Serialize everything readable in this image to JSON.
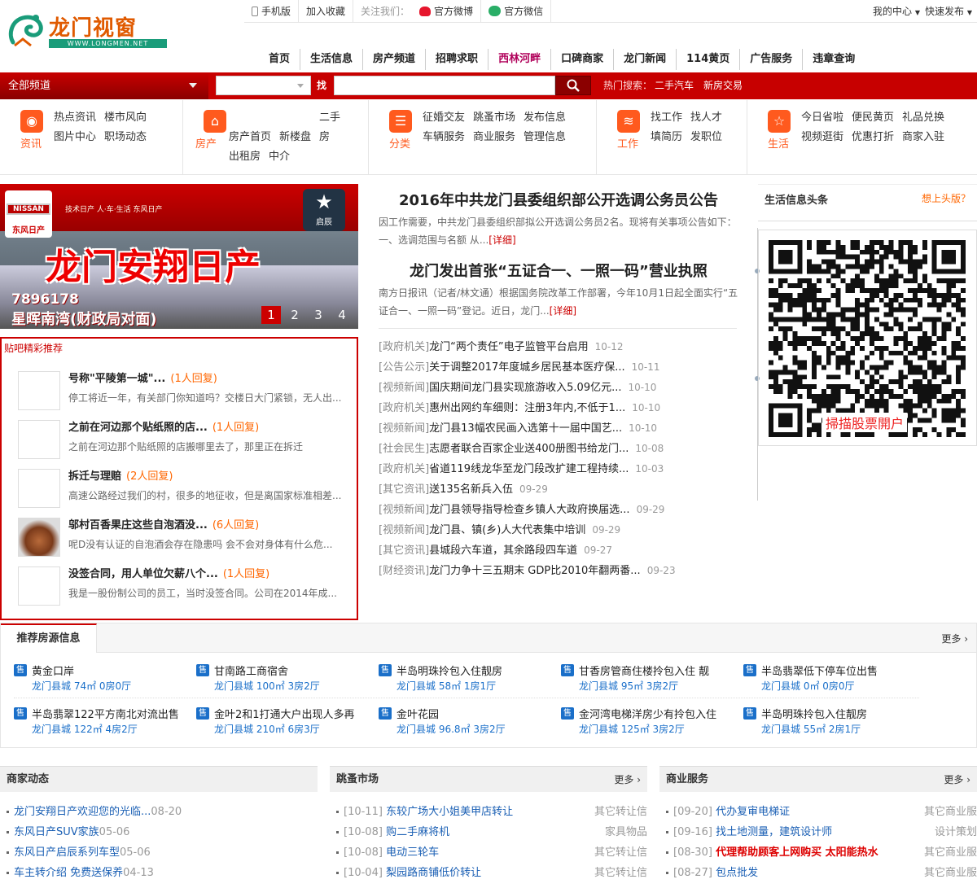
{
  "topbar": {
    "mobile": "手机版",
    "favorite": "加入收藏",
    "follow_label": "关注我们：",
    "weibo": "官方微博",
    "wechat": "官方微信",
    "my_center": "我的中心",
    "quick_post": "快速发布"
  },
  "logo": {
    "text": "龙门视窗",
    "url_text": "WWW.LONGMEN.NET"
  },
  "nav": [
    "首页",
    "生活信息",
    "房产频道",
    "招聘求职",
    "西林河畔",
    "口碑商家",
    "龙门新闻",
    "114黄页",
    "广告服务",
    "违章查询"
  ],
  "search": {
    "all_channels": "全部频道",
    "find_label": "找",
    "hot_label": "热门搜索：",
    "hot_items": [
      "二手汽车",
      "新房交易"
    ]
  },
  "categories": [
    {
      "icon": "news-icon",
      "name": "资讯",
      "links": [
        "热点资讯",
        "楼市风向",
        "图片中心",
        "职场动态"
      ]
    },
    {
      "icon": "house-icon",
      "name": "房产",
      "links": [
        "房产首页",
        "新楼盘",
        "二手房",
        "出租房",
        "中介"
      ]
    },
    {
      "icon": "list-icon",
      "name": "分类",
      "links": [
        "征婚交友",
        "跳蚤市场",
        "发布信息",
        "车辆服务",
        "商业服务",
        "管理信息"
      ]
    },
    {
      "icon": "layers-icon",
      "name": "工作",
      "links": [
        "找工作",
        "找人才",
        "填简历",
        "发职位"
      ]
    },
    {
      "icon": "star-icon",
      "name": "生活",
      "links": [
        "今日省啦",
        "便民黄页",
        "礼品兑换",
        "视频逛街",
        "优惠打折",
        "商家入驻"
      ]
    }
  ],
  "banner": {
    "title": "龙门安翔日产",
    "phone": "7896178",
    "address": "星晖南湾(财政局对面)",
    "dealer": "东风日产",
    "slogan": "技术日产 人·车·生活 东风日产",
    "brand": "NISSAN",
    "brand2": "启辰",
    "pages": [
      "1",
      "2",
      "3",
      "4"
    ]
  },
  "hot_posts": {
    "title": "贴吧精彩推荐",
    "posts": [
      {
        "title": "号称\"平陵第一城\"...",
        "replies": "(1人回复)",
        "summary": "停工将近一年，有关部门你知道吗？交楼日大门紧锁，无人出..."
      },
      {
        "title": "之前在河边那个贴纸照的店...",
        "replies": "(1人回复)",
        "summary": "之前在河边那个贴纸照的店搬哪里去了，那里正在拆迁"
      },
      {
        "title": "拆迁与理赔",
        "replies": "(2人回复)",
        "summary": "高速公路经过我们的村，很多的地征收，但是离国家标准相差..."
      },
      {
        "title": "邬村百香果庄这些自泡酒没...",
        "replies": "(6人回复)",
        "summary": "呢D没有认证的自泡酒会存在隐患吗 会不会对身体有什么危..."
      },
      {
        "title": "没签合同，用人单位欠薪八个...",
        "replies": "(1人回复)",
        "summary": "我是一股份制公司的员工，当时没签合同。公司在2014年成..."
      }
    ]
  },
  "headlines": [
    {
      "title": "2016年中共龙门县委组织部公开选调公务员公告",
      "summary": "因工作需要，中共龙门县委组织部拟公开选调公务员2名。现将有关事项公告如下：一、选调范围与名额 从...",
      "more": "[详细]"
    },
    {
      "title": "龙门发出首张“五证合一、一照一码”营业执照",
      "summary": "南方日报讯（记者/林文通）根据国务院改革工作部署，今年10月1日起全面实行“五证合一、一照一码”登记。近日，龙门...",
      "more": "[详细]"
    }
  ],
  "news": [
    {
      "cat": "[政府机关]",
      "title": "龙门“两个责任”电子监管平台启用",
      "date": "10-12"
    },
    {
      "cat": "[公告公示]",
      "title": "关于调整2017年度城乡居民基本医疗保...",
      "date": "10-11"
    },
    {
      "cat": "[视频新闻]",
      "title": "国庆期间龙门县实现旅游收入5.09亿元...",
      "date": "10-10"
    },
    {
      "cat": "[政府机关]",
      "title": "惠州出网约车细则：注册3年内,不低于1...",
      "date": "10-10"
    },
    {
      "cat": "[视频新闻]",
      "title": "龙门县13幅农民画入选第十一届中国艺...",
      "date": "10-10"
    },
    {
      "cat": "[社会民生]",
      "title": "志愿者联合百家企业送400册图书给龙门...",
      "date": "10-08"
    },
    {
      "cat": "[政府机关]",
      "title": "省道119线龙华至龙门段改扩建工程持续...",
      "date": "10-03"
    },
    {
      "cat": "[其它资讯]",
      "title": "送135名新兵入伍",
      "date": "09-29"
    },
    {
      "cat": "[视频新闻]",
      "title": "龙门县领导指导检查乡镇人大政府换届选...",
      "date": "09-29"
    },
    {
      "cat": "[视频新闻]",
      "title": "龙门县、镇(乡)人大代表集中培训",
      "date": "09-29"
    },
    {
      "cat": "[其它资讯]",
      "title": "县城段六车道，其余路段四车道",
      "date": "09-27"
    },
    {
      "cat": "[财经资讯]",
      "title": "龙门力争十三五期末 GDP比2010年翻两番...",
      "date": "09-23"
    }
  ],
  "sidebar": {
    "title": "生活信息头条",
    "link": "想上头版？",
    "qr_caption": "掃描股票開户"
  },
  "houses": {
    "title": "推荐房源信息",
    "more": "更多 ›",
    "badge": "售",
    "items": [
      {
        "name": "黄金口岸",
        "sub": "龙门县城 74㎡ 0房0厅"
      },
      {
        "name": "甘南路工商宿舍",
        "sub": "龙门县城 100㎡ 3房2厅"
      },
      {
        "name": "半岛明珠拎包入住靓房",
        "sub": "龙门县城 58㎡ 1房1厅"
      },
      {
        "name": "甘香房管商住楼拎包入住 靓",
        "sub": "龙门县城 95㎡ 3房2厅"
      },
      {
        "name": "半岛翡翠低下停车位出售",
        "sub": "龙门县城 0㎡ 0房0厅"
      },
      {
        "name": "半岛翡翠122平方南北对流出售",
        "sub": "龙门县城 122㎡ 4房2厅"
      },
      {
        "name": "金叶2和1打通大户出现人多再",
        "sub": "龙门县城 210㎡ 6房3厅"
      },
      {
        "name": "金叶花园",
        "sub": "龙门县城 96.8㎡ 3房2厅"
      },
      {
        "name": "金河湾电梯洋房少有拎包入住",
        "sub": "龙门县城 125㎡ 3房2厅"
      },
      {
        "name": "半岛明珠拎包入住靓房",
        "sub": "龙门县城 55㎡ 2房1厅"
      }
    ]
  },
  "merchant": {
    "title": "商家动态",
    "items": [
      {
        "title": "龙门安翔日产欢迎您的光临...",
        "date": "08-20"
      },
      {
        "title": "东风日产SUV家族",
        "date": "05-06"
      },
      {
        "title": "东风日产启辰系列车型",
        "date": "05-06"
      },
      {
        "title": "车主转介绍 免费送保养",
        "date": "04-13"
      }
    ]
  },
  "flea": {
    "title": "跳蚤市场",
    "more": "更多 ›",
    "items": [
      {
        "date": "[10-11]",
        "title": "东较广场大小姐美甲店转让",
        "cat": "其它转让信"
      },
      {
        "date": "[10-08]",
        "title": "购二手麻将机",
        "cat": "家具物品"
      },
      {
        "date": "[10-08]",
        "title": "电动三轮车",
        "cat": "其它转让信"
      },
      {
        "date": "[10-04]",
        "title": "梨园路商铺低价转让",
        "cat": "其它转让信"
      }
    ]
  },
  "business": {
    "title": "商业服务",
    "more": "更多 ›",
    "items": [
      {
        "date": "[09-20]",
        "title": "代办复审电梯证",
        "cat": "其它商业服",
        "red": false
      },
      {
        "date": "[09-16]",
        "title": "找土地测量，建筑设计师",
        "cat": "设计策划",
        "red": false
      },
      {
        "date": "[08-30]",
        "title": "代理帮助顾客上网购买 太阳能热水",
        "cat": "其它商业服",
        "red": true
      },
      {
        "date": "[08-27]",
        "title": "包点批发",
        "cat": "其它商业服",
        "red": false
      }
    ]
  },
  "colors": {
    "brand_red": "#c70000",
    "accent_orange": "#ff5a1e",
    "link_blue": "#1a5fb4",
    "logo_green": "#1a9c7a"
  }
}
